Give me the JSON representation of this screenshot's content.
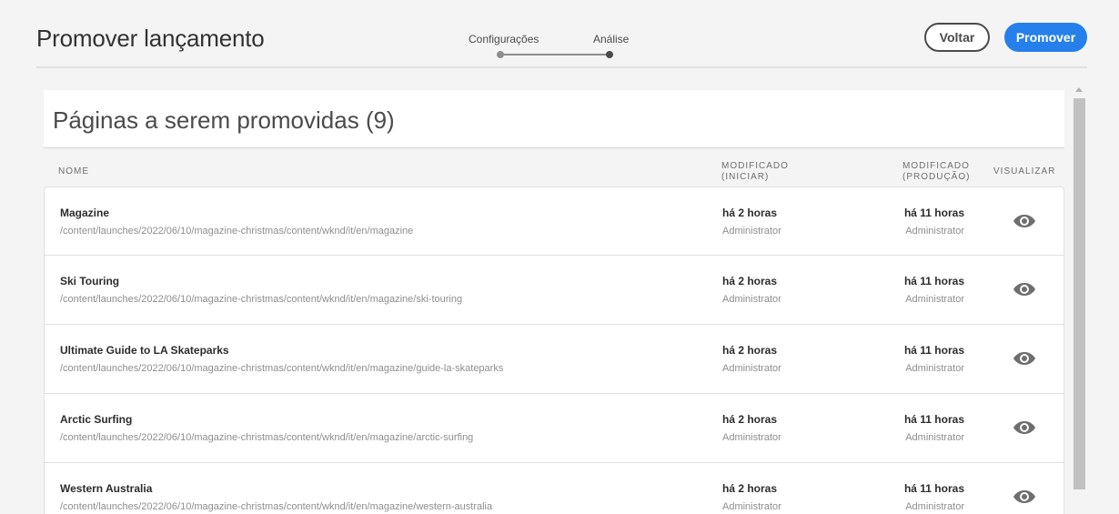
{
  "header": {
    "title": "Promover lançamento",
    "wizard": {
      "steps": [
        "Configurações",
        "Análise"
      ],
      "current": "Análise"
    },
    "back_label": "Voltar",
    "promote_label": "Promover"
  },
  "panel": {
    "title": "Páginas a serem promovidas (9)",
    "columns": {
      "name": "NOME",
      "modified_launch": "MODIFICADO (INICIAR)",
      "modified_production": "MODIFICADO (PRODUÇÃO)",
      "view": "VISUALIZAR"
    },
    "rows": [
      {
        "title": "Magazine",
        "path": "/content/launches/2022/06/10/magazine-christmas/content/wknd/it/en/magazine",
        "mod_launch": "há 2 horas",
        "by_launch": "Administrator",
        "mod_prod": "há 11 horas",
        "by_prod": "Administrator"
      },
      {
        "title": "Ski Touring",
        "path": "/content/launches/2022/06/10/magazine-christmas/content/wknd/it/en/magazine/ski-touring",
        "mod_launch": "há 2 horas",
        "by_launch": "Administrator",
        "mod_prod": "há 11 horas",
        "by_prod": "Administrator"
      },
      {
        "title": "Ultimate Guide to LA Skateparks",
        "path": "/content/launches/2022/06/10/magazine-christmas/content/wknd/it/en/magazine/guide-la-skateparks",
        "mod_launch": "há 2 horas",
        "by_launch": "Administrator",
        "mod_prod": "há 11 horas",
        "by_prod": "Administrator"
      },
      {
        "title": "Arctic Surfing",
        "path": "/content/launches/2022/06/10/magazine-christmas/content/wknd/it/en/magazine/arctic-surfing",
        "mod_launch": "há 2 horas",
        "by_launch": "Administrator",
        "mod_prod": "há 11 horas",
        "by_prod": "Administrator"
      },
      {
        "title": "Western Australia",
        "path": "/content/launches/2022/06/10/magazine-christmas/content/wknd/it/en/magazine/western-australia",
        "mod_launch": "há 2 horas",
        "by_launch": "Administrator",
        "mod_prod": "há 11 horas",
        "by_prod": "Administrator"
      }
    ],
    "view_icon": "eye-icon"
  },
  "colors": {
    "accent": "#2680eb",
    "text": "#2c2c2c",
    "muted": "#8e8e8e"
  }
}
